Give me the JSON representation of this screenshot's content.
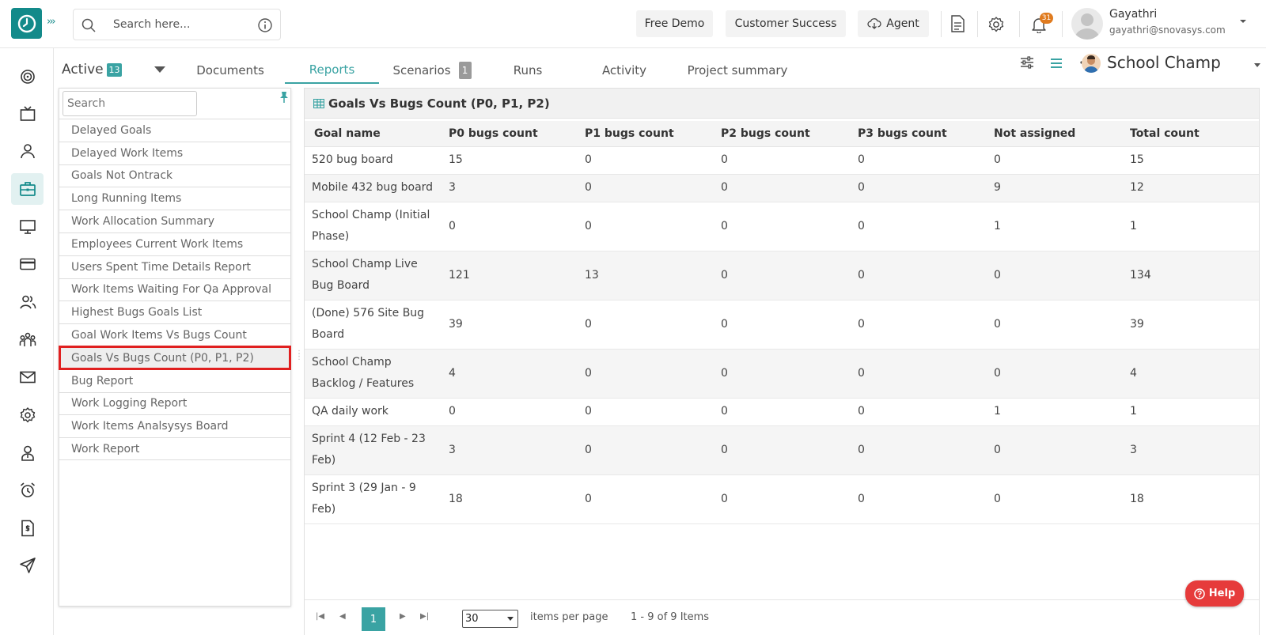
{
  "header": {
    "search_placeholder": "Search here...",
    "free_demo_label": "Free Demo",
    "customer_success_label": "Customer Success",
    "agent_label": "Agent",
    "notification_count": "31",
    "user_name": "Gayathri",
    "user_email": "gayathri@snovasys.com"
  },
  "subheader": {
    "status_label": "Active",
    "status_count": "13",
    "tabs": [
      {
        "label": "Documents"
      },
      {
        "label": "Reports"
      },
      {
        "label": "Scenarios",
        "badge": "1"
      },
      {
        "label": "Runs"
      },
      {
        "label": "Activity"
      },
      {
        "label": "Project summary"
      }
    ],
    "active_tab": "Reports",
    "project_name": "School Champ"
  },
  "report_list": {
    "search_placeholder": "Search",
    "items": [
      "Delayed Goals",
      "Delayed Work Items",
      "Goals Not Ontrack",
      "Long Running Items",
      "Work Allocation Summary",
      "Employees Current Work Items",
      "Users Spent Time Details Report",
      "Work Items Waiting For Qa Approval",
      "Highest Bugs Goals List",
      "Goal Work Items Vs Bugs Count",
      "Goals Vs Bugs Count (P0, P1, P2)",
      "Bug Report",
      "Work Logging Report",
      "Work Items Analsysys Board",
      "Work Report"
    ],
    "selected": "Goals Vs Bugs Count (P0, P1, P2)"
  },
  "report": {
    "title": "Goals Vs Bugs Count (P0, P1, P2)",
    "columns": [
      "Goal name",
      "P0 bugs count",
      "P1 bugs count",
      "P2 bugs count",
      "P3 bugs count",
      "Not assigned",
      "Total count"
    ],
    "rows": [
      [
        "520 bug board",
        "15",
        "0",
        "0",
        "0",
        "0",
        "15"
      ],
      [
        "Mobile 432 bug board",
        "3",
        "0",
        "0",
        "0",
        "9",
        "12"
      ],
      [
        "School Champ (Initial Phase)",
        "0",
        "0",
        "0",
        "0",
        "1",
        "1"
      ],
      [
        "School Champ Live Bug Board",
        "121",
        "13",
        "0",
        "0",
        "0",
        "134"
      ],
      [
        "(Done) 576 Site Bug Board",
        "39",
        "0",
        "0",
        "0",
        "0",
        "39"
      ],
      [
        "School Champ Backlog / Features",
        "4",
        "0",
        "0",
        "0",
        "0",
        "4"
      ],
      [
        "QA daily work",
        "0",
        "0",
        "0",
        "0",
        "1",
        "1"
      ],
      [
        "Sprint 4 (12 Feb - 23 Feb)",
        "3",
        "0",
        "0",
        "0",
        "0",
        "3"
      ],
      [
        "Sprint 3 (29 Jan - 9 Feb)",
        "18",
        "0",
        "0",
        "0",
        "0",
        "18"
      ]
    ],
    "pager": {
      "current_page": "1",
      "page_size": "30",
      "items_per_page_label": "items per page",
      "info": "1 - 9 of 9 Items"
    }
  },
  "help_label": "Help",
  "colors": {
    "accent": "#3aa3a3",
    "brand": "#138a8a",
    "selection_outline": "#e02020",
    "help_button": "#e63b3b",
    "notification_badge": "#e07b1f"
  }
}
